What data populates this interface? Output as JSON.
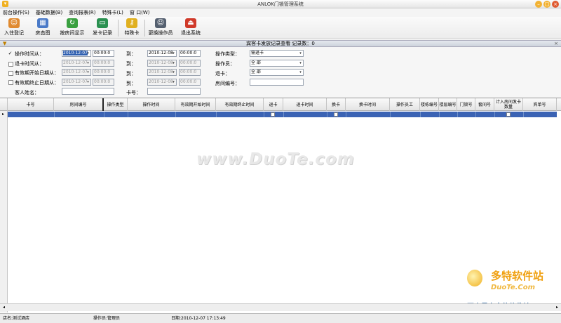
{
  "window": {
    "title": "ANLOK门锁管理系统"
  },
  "menu": [
    "前台操作(S)",
    "基础数据(B)",
    "查询报表(R)",
    "特殊卡(L)",
    "窗 口(W)"
  ],
  "toolbar": {
    "checkin": "入住登记",
    "roommap": "房态图",
    "roomdisplay": "按房间显示",
    "cardrecord": "发卡记录",
    "specialcard": "特殊卡",
    "changeoperator": "更换操作员",
    "exit": "退出系统"
  },
  "panel": {
    "title": "宾客卡发放记录查看 记录数：0"
  },
  "filters": {
    "optime_label": "操作时间从：",
    "optime_from": "2010-12-07",
    "optime_from_time": "00:00:0",
    "checkout_label": "退卡时间从：",
    "checkout_from": "2010-12-07",
    "checkout_from_time": "00:00:0",
    "validstart_label": "有效期开始日期从：",
    "validstart_from": "2010-12-07",
    "validstart_from_time": "00:00:0",
    "validend_label": "有效期终止日期从：",
    "validend_from": "2010-12-07",
    "validend_from_time": "00:00:0",
    "guestname_label": "客人姓名：",
    "to_label": "到：",
    "optime_to": "2010-12-08",
    "optime_to_time": "00:00:0",
    "checkout_to": "2010-12-08",
    "checkout_to_time": "00:00:0",
    "validstart_to": "2010-12-08",
    "validstart_to_time": "00:00:0",
    "validend_to": "2010-12-08",
    "validend_to_time": "00:00:0",
    "cardno_label": "卡号：",
    "optype_label": "操作类型：",
    "optype_value": "需退卡",
    "operator_label": "操作员：",
    "operator_value": "全 部",
    "returned_label": "退卡：",
    "returned_value": "全 部",
    "roomno_label": "房间编号："
  },
  "grid": {
    "columns": [
      "卡号",
      "房间编号",
      "操作类型",
      "操作时间",
      "有效期开始时间",
      "有效期终止时间",
      "退卡",
      "退卡时间",
      "换卡",
      "换卡时间",
      "操作员工",
      "楼栋编号",
      "楼层编号",
      "门锁号",
      "套间号",
      "计入房间发卡数量",
      "宾单号"
    ]
  },
  "watermark": "www.DuoTe.com",
  "logo": {
    "line1": "多特软件站",
    "line2": "DuoTe.Com",
    "line3": "国内最安全的软件站"
  },
  "status": {
    "store": "店名:测试酒店",
    "operator": "操作员:管理员",
    "date": "日期:2010-12-07 17:13:49"
  }
}
